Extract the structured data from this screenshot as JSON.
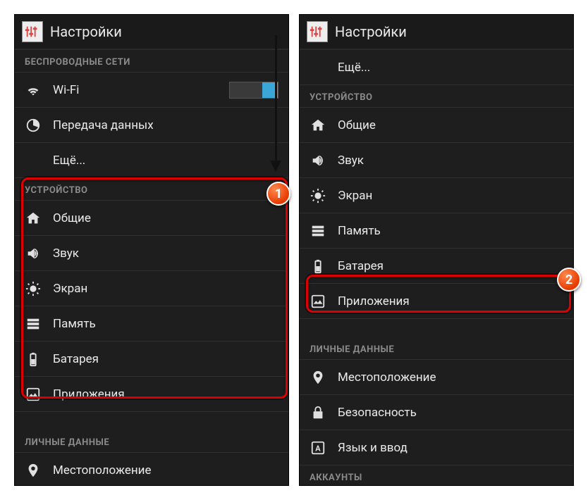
{
  "title": "Настройки",
  "left": {
    "wireless_header": "БЕСПРОВОДНЫЕ СЕТИ",
    "wifi": "Wi-Fi",
    "data_usage": "Передача данных",
    "more": "Ещё...",
    "device_header": "УСТРОЙСТВО",
    "general": "Общие",
    "sound": "Звук",
    "display": "Экран",
    "storage": "Память",
    "battery": "Батарея",
    "apps": "Приложения",
    "personal_header": "ЛИЧНЫЕ ДАННЫЕ",
    "location": "Местоположение"
  },
  "right": {
    "more": "Ещё...",
    "device_header": "УСТРОЙСТВО",
    "general": "Общие",
    "sound": "Звук",
    "display": "Экран",
    "storage": "Память",
    "battery": "Батарея",
    "apps": "Приложения",
    "personal_header": "ЛИЧНЫЕ ДАННЫЕ",
    "location": "Местоположение",
    "security": "Безопасность",
    "language": "Язык и ввод",
    "accounts_header": "АККАУНТЫ"
  },
  "badges": {
    "one": "1",
    "two": "2"
  }
}
